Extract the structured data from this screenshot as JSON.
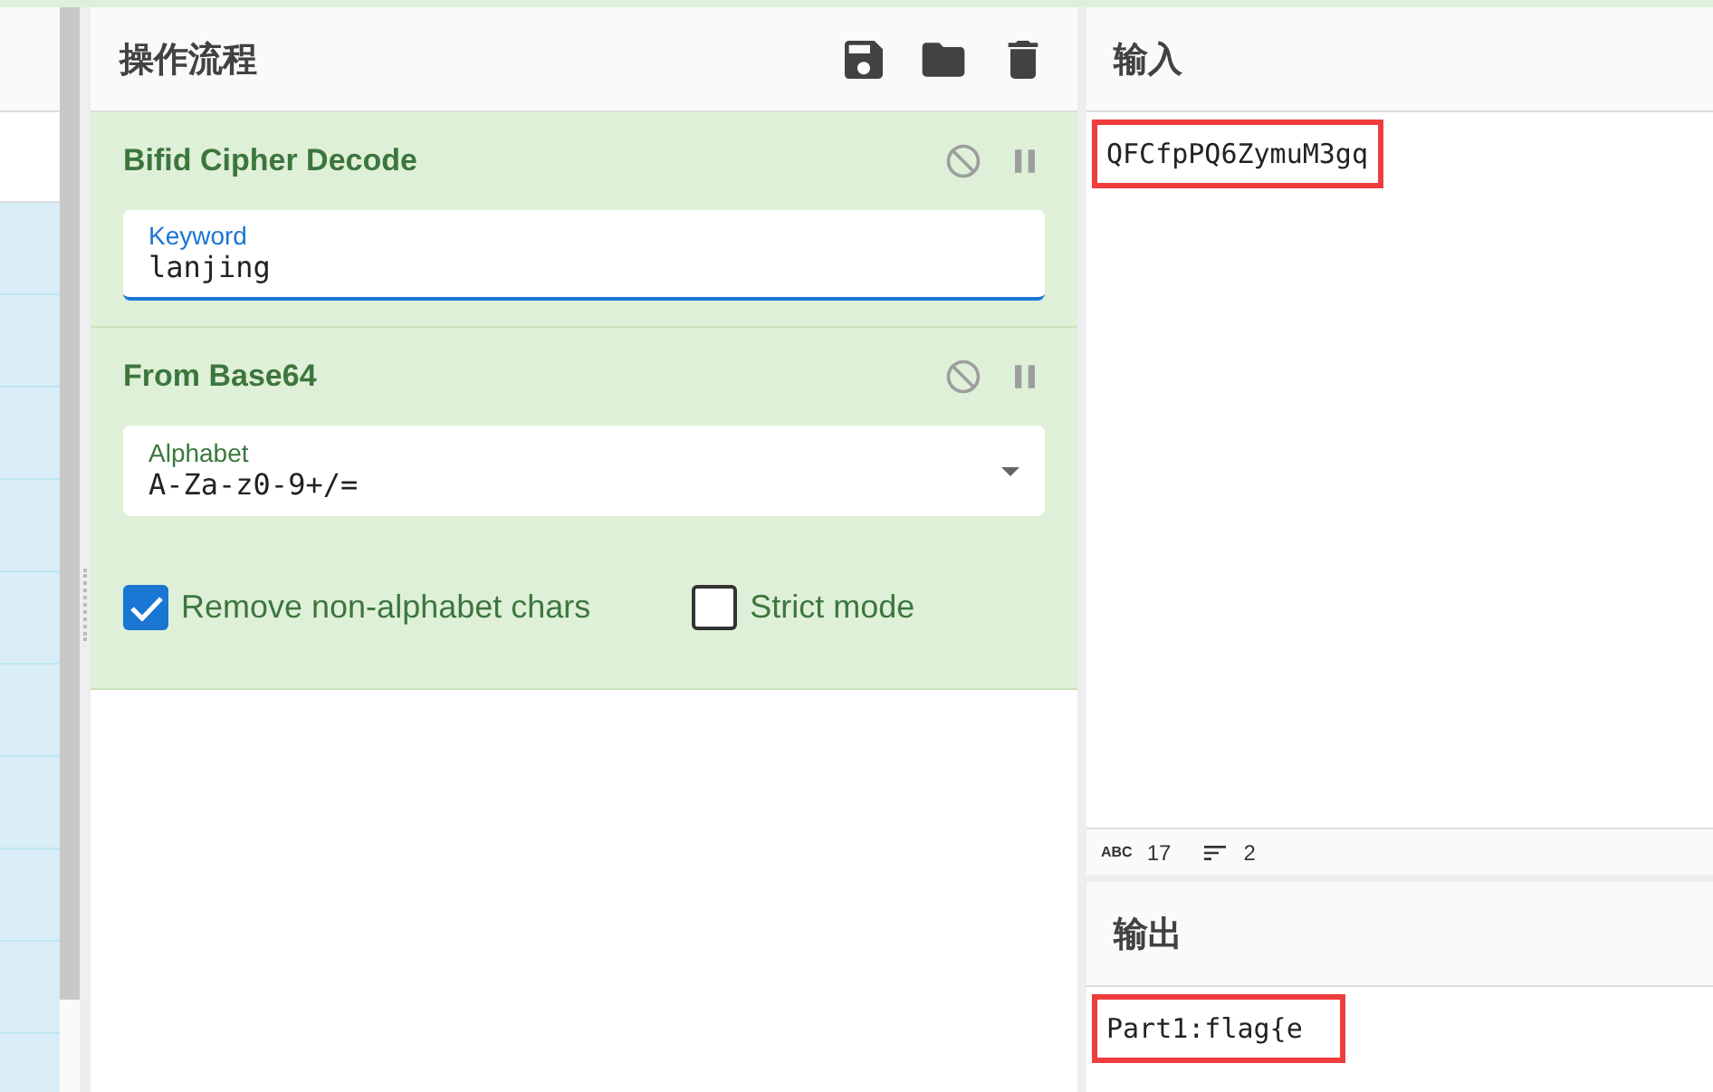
{
  "recipe": {
    "title": "操作流程",
    "operations": [
      {
        "name": "Bifid Cipher Decode",
        "args": [
          {
            "kind": "text",
            "label": "Keyword",
            "value": "lanjing",
            "focused": true
          }
        ]
      },
      {
        "name": "From Base64",
        "args": [
          {
            "kind": "select",
            "label": "Alphabet",
            "value": "A-Za-z0-9+/=",
            "focused": false
          },
          {
            "kind": "checkbox",
            "label": "Remove non-alphabet chars",
            "checked": true
          },
          {
            "kind": "checkbox",
            "label": "Strict mode",
            "checked": false
          }
        ]
      }
    ]
  },
  "input": {
    "title": "输入",
    "value": "QFCfpPQ6ZymuM3gq",
    "highlighted": true,
    "stats": [
      {
        "kind": "length",
        "icon_label": "ABC",
        "value": "17"
      },
      {
        "kind": "lines",
        "value": "2"
      }
    ]
  },
  "output": {
    "title": "输出",
    "value": "Part1:flag{e",
    "highlighted": true
  }
}
